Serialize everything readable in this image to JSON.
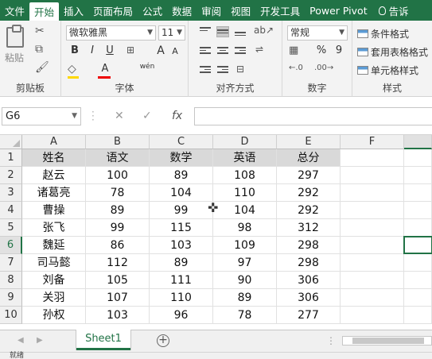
{
  "tabs": [
    "文件",
    "开始",
    "插入",
    "页面布局",
    "公式",
    "数据",
    "审阅",
    "视图",
    "开发工具",
    "Power Pivot",
    "告诉"
  ],
  "active_tab": 1,
  "ribbon": {
    "clipboard": {
      "paste_label": "粘贴",
      "group_label": "剪贴板"
    },
    "font": {
      "font_name": "微软雅黑",
      "font_size": "11",
      "bold": "B",
      "italic": "I",
      "underline": "U",
      "grow": "A",
      "shrink": "A",
      "font_color": "A",
      "wen": "wén",
      "group_label": "字体"
    },
    "alignment": {
      "group_label": "对齐方式"
    },
    "number": {
      "format": "常规",
      "percent": "%",
      "comma": "9",
      "group_label": "数字"
    },
    "styles": {
      "conditional": "条件格式",
      "table": "套用表格格式",
      "cell": "单元格样式",
      "group_label": "样式"
    }
  },
  "formula_bar": {
    "name_box": "G6",
    "cancel": "✕",
    "enter": "✓",
    "fx": "fx",
    "value": ""
  },
  "columns": [
    "A",
    "B",
    "C",
    "D",
    "E",
    "F"
  ],
  "rows": [
    "1",
    "2",
    "3",
    "4",
    "5",
    "6",
    "7",
    "8",
    "9",
    "10"
  ],
  "table": [
    [
      "姓名",
      "语文",
      "数学",
      "英语",
      "总分"
    ],
    [
      "赵云",
      "100",
      "89",
      "108",
      "297"
    ],
    [
      "诸葛亮",
      "78",
      "104",
      "110",
      "292"
    ],
    [
      "曹操",
      "89",
      "99",
      "104",
      "292"
    ],
    [
      "张飞",
      "99",
      "115",
      "98",
      "312"
    ],
    [
      "魏延",
      "86",
      "103",
      "109",
      "298"
    ],
    [
      "司马懿",
      "112",
      "89",
      "97",
      "298"
    ],
    [
      "刘备",
      "105",
      "111",
      "90",
      "306"
    ],
    [
      "关羽",
      "107",
      "110",
      "89",
      "306"
    ],
    [
      "孙权",
      "103",
      "96",
      "78",
      "277"
    ]
  ],
  "sheet_tab": "Sheet1",
  "add_sheet": "+",
  "status": "就绪",
  "colors": {
    "accent": "#217346",
    "header_fill": "#d9d9d9"
  }
}
